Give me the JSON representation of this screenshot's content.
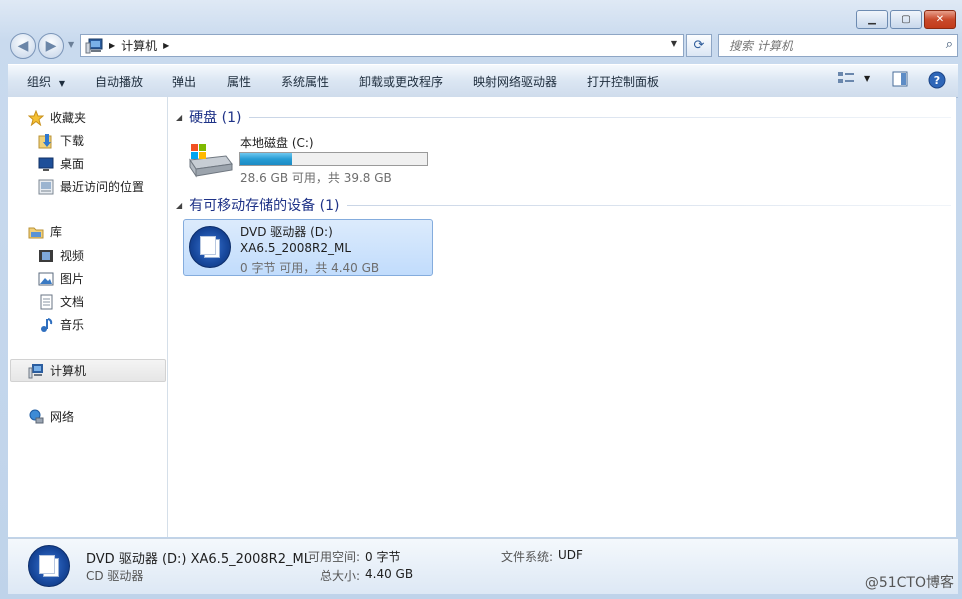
{
  "window": {
    "caption_buttons": {
      "minimize_symbol": "▁",
      "maximize_symbol": "▢",
      "close_symbol": "✕"
    }
  },
  "address_bar": {
    "breadcrumb": [
      "计算机"
    ],
    "search_placeholder": "搜索 计算机"
  },
  "toolbar": {
    "organize": "组织",
    "items": [
      "自动播放",
      "弹出",
      "属性",
      "系统属性",
      "卸载或更改程序",
      "映射网络驱动器",
      "打开控制面板"
    ]
  },
  "nav_pane": {
    "favorites": {
      "label": "收藏夹",
      "items": [
        "下载",
        "桌面",
        "最近访问的位置"
      ]
    },
    "libraries": {
      "label": "库",
      "items": [
        "视频",
        "图片",
        "文档",
        "音乐"
      ]
    },
    "computer": "计算机",
    "network": "网络"
  },
  "content": {
    "groups": [
      {
        "header": "硬盘 (1)",
        "drives": [
          {
            "name": "本地磁盘 (C:)",
            "free_text": "28.6 GB 可用，共 39.8 GB",
            "used_fraction": 0.28
          }
        ]
      },
      {
        "header": "有可移动存储的设备 (1)",
        "drives": [
          {
            "name": "DVD 驱动器 (D:)",
            "volume": "XA6.5_2008R2_ML",
            "free_text": "0 字节 可用，共 4.40 GB",
            "selected": true
          }
        ]
      }
    ]
  },
  "details_pane": {
    "title": "DVD 驱动器 (D:) XA6.5_2008R2_ML",
    "type": "CD 驱动器",
    "free_space_label": "可用空间:",
    "free_space_value": "0 字节",
    "total_size_label": "总大小:",
    "total_size_value": "4.40 GB",
    "fs_label": "文件系统:",
    "fs_value": "UDF"
  },
  "watermark": "@51CTO博客",
  "colors": {
    "group_header": "#1e3287",
    "selection": "#c1dcfc",
    "progress": "#279cd4"
  }
}
